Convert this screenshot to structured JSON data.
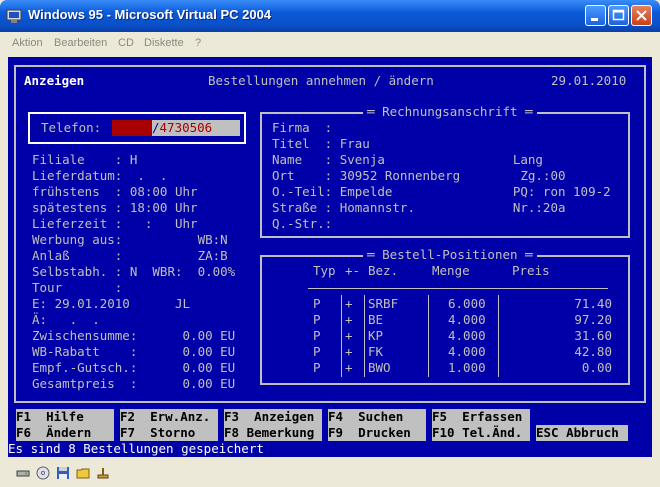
{
  "window": {
    "title": "Windows 95 - Microsoft Virtual PC 2004",
    "menu": [
      "Aktion",
      "Bearbeiten",
      "CD",
      "Diskette",
      "?"
    ]
  },
  "dos": {
    "header": {
      "mode": "Anzeigen",
      "title": "Bestellungen annehmen / ändern",
      "date": "29.01.2010"
    },
    "telefon": {
      "label": "Telefon:",
      "prefix": "",
      "number": "4730506"
    },
    "left_fields": [
      "Filiale    : H",
      "Lieferdatum:  .  .",
      "frühstens  : 08:00 Uhr",
      "spätestens : 18:00 Uhr",
      "Lieferzeit :   :   Uhr",
      "Werbung aus:          WB:N",
      "Anlaß      :          ZA:B",
      "Selbstabh. : N  WBR:  0.00%",
      "Tour       :",
      "E: 29.01.2010      JL",
      "Ä:   .  .",
      "Zwischensumme:      0.00 EU",
      "WB-Rabatt    :      0.00 EU",
      "Empf.-Gutsch.:      0.00 EU",
      "Gesamtpreis  :      0.00 EU"
    ],
    "rechnung": {
      "title": "Rechnungsanschrift",
      "lines": [
        "Firma  :",
        "Titel  : Frau",
        "Name   : Svenja                 Lang",
        "Ort    : 30952 Ronnenberg        Zg.:00",
        "O.-Teil: Empelde                PQ: ron 109-2",
        "Straße : Homannstr.             Nr.:20a",
        "Q.-Str.:"
      ]
    },
    "positionen": {
      "title": "Bestell-Positionen",
      "headers": {
        "typ": "Typ",
        "pm": "+-",
        "bez": "Bez.",
        "menge": "Menge",
        "preis": "Preis"
      },
      "rows": [
        {
          "typ": "P",
          "pm": "+",
          "bez": "SRBF",
          "menge": "6.000",
          "preis": "71.40"
        },
        {
          "typ": "P",
          "pm": "+",
          "bez": "BE",
          "menge": "4.000",
          "preis": "97.20"
        },
        {
          "typ": "P",
          "pm": "+",
          "bez": "KP",
          "menge": "4.000",
          "preis": "31.60"
        },
        {
          "typ": "P",
          "pm": "+",
          "bez": "FK",
          "menge": "4.000",
          "preis": "42.80"
        },
        {
          "typ": "P",
          "pm": "+",
          "bez": "BWO",
          "menge": "1.000",
          "preis": "0.00"
        }
      ]
    },
    "fkeys_row1": [
      "F1  Hilfe",
      "F2  Erw.Anz.",
      "F3  Anzeigen",
      "F4  Suchen",
      "F5  Erfassen"
    ],
    "fkeys_row2": [
      "F6  Ändern",
      "F7  Storno",
      "F8 Bemerkung",
      "F9  Drucken",
      "F10 Tel.Änd.",
      "ESC Abbruch"
    ],
    "status": "Es sind 8 Bestellungen gespeichert"
  },
  "colors": {
    "dos_bg": "#0000a8",
    "dos_fg": "#c0c0c0",
    "fkey_bg": "#c0c0c0",
    "input_red": "#a80000",
    "xp_title": "#0a5ad8"
  }
}
